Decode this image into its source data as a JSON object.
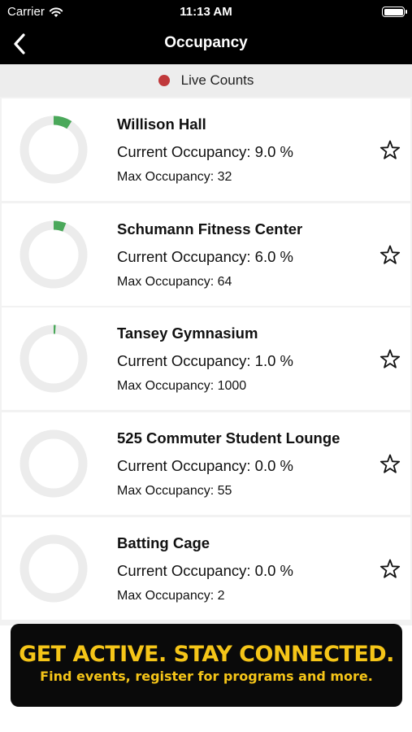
{
  "status_bar": {
    "carrier": "Carrier",
    "time": "11:13 AM",
    "wifi_icon": "wifi-icon",
    "battery_icon": "battery-icon"
  },
  "nav": {
    "title": "Occupancy",
    "back_icon": "chevron-left-icon"
  },
  "live": {
    "label": "Live Counts",
    "dot_color": "#c0393b"
  },
  "colors": {
    "ring_track": "#ececec",
    "ring_fill": "#4aa85a",
    "banner_text": "#f5c518"
  },
  "facilities": [
    {
      "name": "Willison Hall",
      "occupancy": "Current Occupancy: 9.0 %",
      "occupancy_pct": 9.0,
      "max": "Max Occupancy: 32",
      "favorite_icon": "star-outline-icon"
    },
    {
      "name": "Schumann Fitness Center",
      "occupancy": "Current Occupancy: 6.0 %",
      "occupancy_pct": 6.0,
      "max": "Max Occupancy: 64",
      "favorite_icon": "star-outline-icon"
    },
    {
      "name": "Tansey Gymnasium",
      "occupancy": "Current Occupancy: 1.0 %",
      "occupancy_pct": 1.0,
      "max": "Max Occupancy: 1000",
      "favorite_icon": "star-outline-icon"
    },
    {
      "name": "525 Commuter Student Lounge",
      "occupancy": "Current Occupancy: 0.0 %",
      "occupancy_pct": 0.0,
      "max": "Max Occupancy: 55",
      "favorite_icon": "star-outline-icon"
    },
    {
      "name": "Batting Cage",
      "occupancy": "Current Occupancy: 0.0 %",
      "occupancy_pct": 0.0,
      "max": "Max Occupancy: 2",
      "favorite_icon": "star-outline-icon"
    }
  ],
  "banner": {
    "headline": "GET ACTIVE.  STAY CONNECTED.",
    "subtext": "Find events, register for programs and more."
  }
}
